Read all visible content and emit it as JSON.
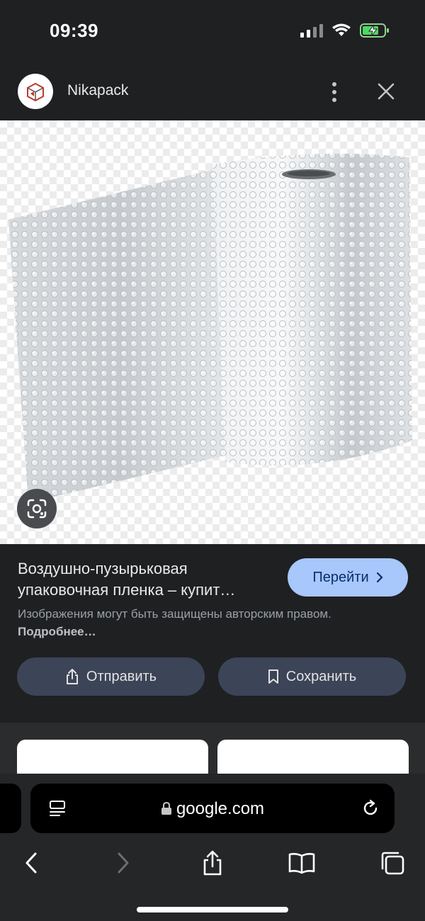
{
  "status_bar": {
    "time": "09:39",
    "icons": [
      "cellular-signal-icon",
      "wifi-icon",
      "battery-charging-icon"
    ]
  },
  "header": {
    "site_name": "Nikapack",
    "icons": [
      "site-logo-icon",
      "more-vert-icon",
      "close-icon"
    ]
  },
  "image": {
    "description_icon": "google-lens-icon"
  },
  "result": {
    "title_line1": "Воздушно-пузырьковая",
    "title_line2": "упаковочная пленка – купит…",
    "visit_label": "Перейти",
    "copyright_text": "Изображения могут быть защищены авторским правом.",
    "learn_more": "Подробнее…",
    "share_label": "Отправить",
    "save_label": "Сохранить"
  },
  "browser": {
    "url": "google.com",
    "icons": [
      "reader-icon",
      "lock-icon",
      "reload-icon",
      "back-icon",
      "forward-icon",
      "share-icon",
      "bookmarks-icon",
      "tabs-icon"
    ]
  },
  "colors": {
    "background": "#1f2022",
    "visit_button": "#a8c7fa",
    "action_button": "#3c4457"
  }
}
